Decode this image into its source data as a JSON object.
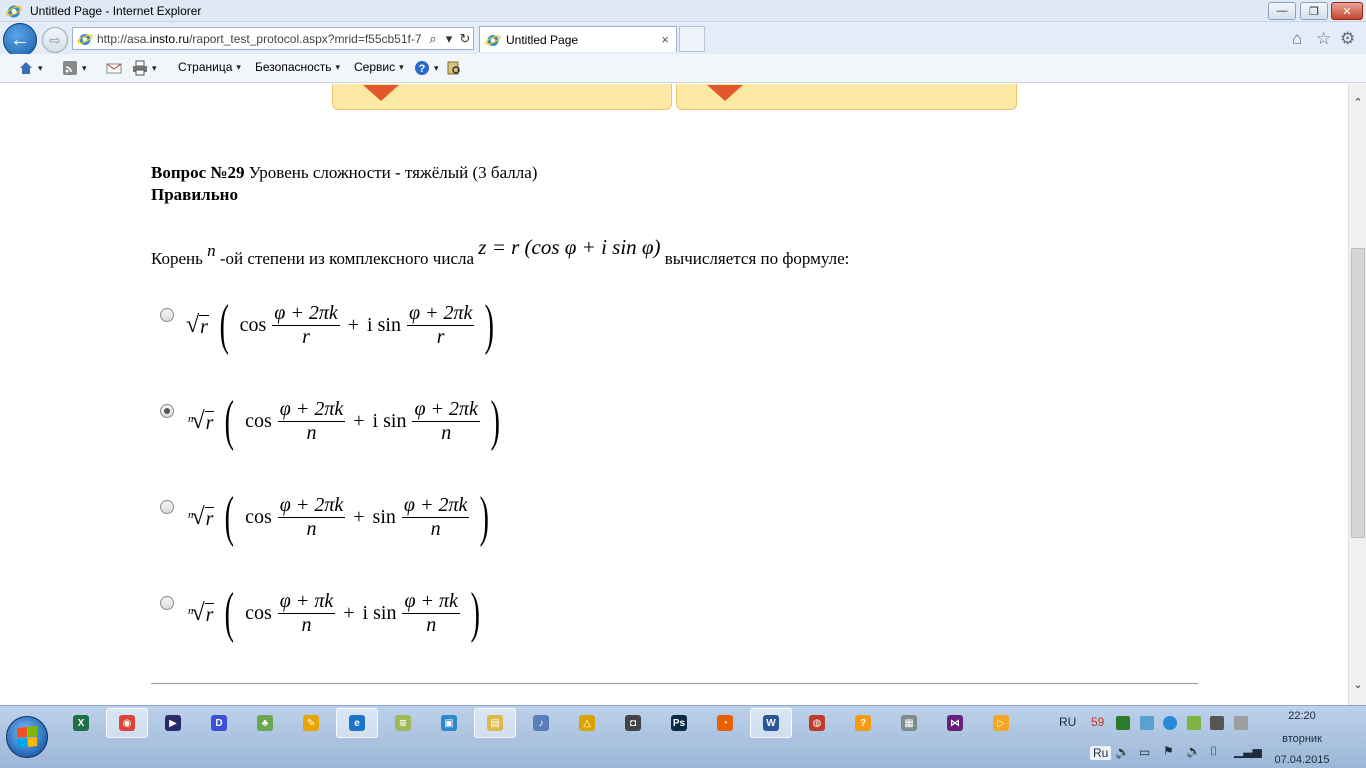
{
  "window": {
    "title": "Untitled Page - Internet Explorer",
    "minimize_label": "—",
    "maximize_label": "❐",
    "close_label": "✕"
  },
  "nav": {
    "url_prefix": "http://asa.",
    "url_domain": "insto.ru",
    "url_rest": "/raport_test_protocol.aspx?mrid=f55cb51f-7",
    "search_glyph": "⌕",
    "dropdown_glyph": "▾",
    "refresh_glyph": "↻",
    "tab_title": "Untitled Page",
    "tab_close": "×",
    "home_glyph": "⌂",
    "favorites_glyph": "☆",
    "tools_glyph": "⚙"
  },
  "commandbar": {
    "page_label": "Страница",
    "safety_label": "Безопасность",
    "service_label": "Сервис",
    "arrow": "▾"
  },
  "question": {
    "number_label": "Вопрос №29",
    "difficulty": " Уровень сложности - тяжёлый (3 балла)",
    "result": "Правильно",
    "text_before": "Корень ",
    "text_n": "n",
    "text_middle": " -ой степени из комплексного числа ",
    "text_formula": "z = r (cos φ + i sin φ)",
    "text_after": " вычисляется по формуле:"
  },
  "options": [
    {
      "root_index": "",
      "numerator": "φ + 2πk",
      "denominator": "r",
      "second_func": "i sin",
      "checked": false
    },
    {
      "root_index": "n",
      "numerator": "φ + 2πk",
      "denominator": "n",
      "second_func": "i sin",
      "checked": true
    },
    {
      "root_index": "n",
      "numerator": "φ + 2πk",
      "denominator": "n",
      "second_func": "sin",
      "checked": false
    },
    {
      "root_index": "n",
      "numerator": "φ + πk",
      "denominator": "n",
      "second_func": "i sin",
      "checked": false
    }
  ],
  "math_common": {
    "sqrt": "√",
    "radicand": "r",
    "cos": "cos",
    "plus": "+",
    "lparen": "(",
    "rparen": ")"
  },
  "scrollbar": {
    "up": "⌃",
    "down": "⌄"
  },
  "taskbar": {
    "lang_top": "RU",
    "lang_bottom": "Ru",
    "badge_number": "59",
    "time": "22:20",
    "weekday": "вторник",
    "date": "07.04.2015",
    "apps": [
      {
        "name": "excel",
        "color": "#1e7145",
        "glyph": "X"
      },
      {
        "name": "chrome",
        "color": "#db4437",
        "glyph": "◉"
      },
      {
        "name": "media-player",
        "color": "#2a2a6a",
        "glyph": "▶"
      },
      {
        "name": "daemon-tools",
        "color": "#3b4fd8",
        "glyph": "D"
      },
      {
        "name": "utility",
        "color": "#6aa84f",
        "glyph": "♣"
      },
      {
        "name": "notes",
        "color": "#e8a400",
        "glyph": "✎"
      },
      {
        "name": "internet-explorer",
        "color": "#1c73c8",
        "glyph": "e"
      },
      {
        "name": "wifi",
        "color": "#9fb85a",
        "glyph": "≋"
      },
      {
        "name": "image-viewer",
        "color": "#2e88c9",
        "glyph": "▣"
      },
      {
        "name": "explorer",
        "color": "#e0b84a",
        "glyph": "▤"
      },
      {
        "name": "audio",
        "color": "#5a7fb8",
        "glyph": "♪"
      },
      {
        "name": "archive",
        "color": "#d8a400",
        "glyph": "△"
      },
      {
        "name": "camera",
        "color": "#444444",
        "glyph": "◘"
      },
      {
        "name": "photoshop",
        "color": "#0b2a4a",
        "glyph": "Ps"
      },
      {
        "name": "firefox",
        "color": "#e66000",
        "glyph": "◔"
      },
      {
        "name": "word",
        "color": "#2b579a",
        "glyph": "W"
      },
      {
        "name": "recorder",
        "color": "#c0392b",
        "glyph": "◍"
      },
      {
        "name": "question-app",
        "color": "#f39c12",
        "glyph": "?"
      },
      {
        "name": "calculator",
        "color": "#7f8c8d",
        "glyph": "▦"
      },
      {
        "name": "visual-studio",
        "color": "#68217a",
        "glyph": "⋈"
      },
      {
        "name": "video-player",
        "color": "#f5a623",
        "glyph": "▷"
      }
    ]
  }
}
